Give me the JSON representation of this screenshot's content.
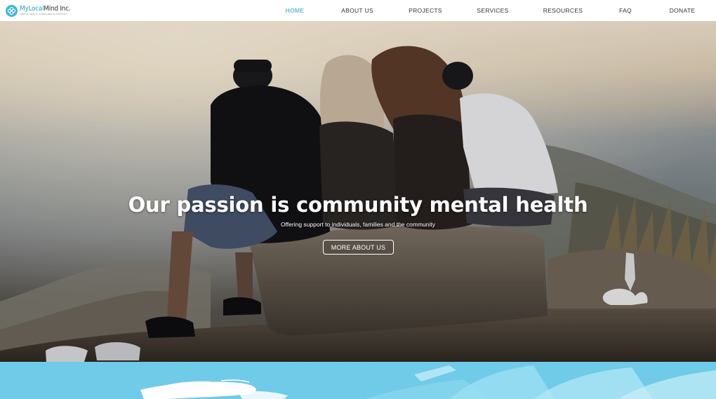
{
  "brand": {
    "name_part1": "MyLocal",
    "name_part2": "Mind Inc.",
    "tagline": "MENTAL HEALTH & WELLBEING SUPPORT",
    "logo_icon": "flower-logo-icon",
    "accent_color": "#2a9fc6"
  },
  "nav": {
    "items": [
      {
        "label": "HOME",
        "active": true
      },
      {
        "label": "ABOUT US",
        "active": false
      },
      {
        "label": "PROJECTS",
        "active": false
      },
      {
        "label": "SERVICES",
        "active": false
      },
      {
        "label": "RESOURCES",
        "active": false
      },
      {
        "label": "FAQ",
        "active": false
      },
      {
        "label": "DONATE",
        "active": false
      }
    ]
  },
  "hero": {
    "title": "Our passion is community mental health",
    "subtitle": "Offering support to individuals, families and the community",
    "button_label": "MORE ABOUT US"
  },
  "band": {
    "color": "#6fcbe8"
  }
}
